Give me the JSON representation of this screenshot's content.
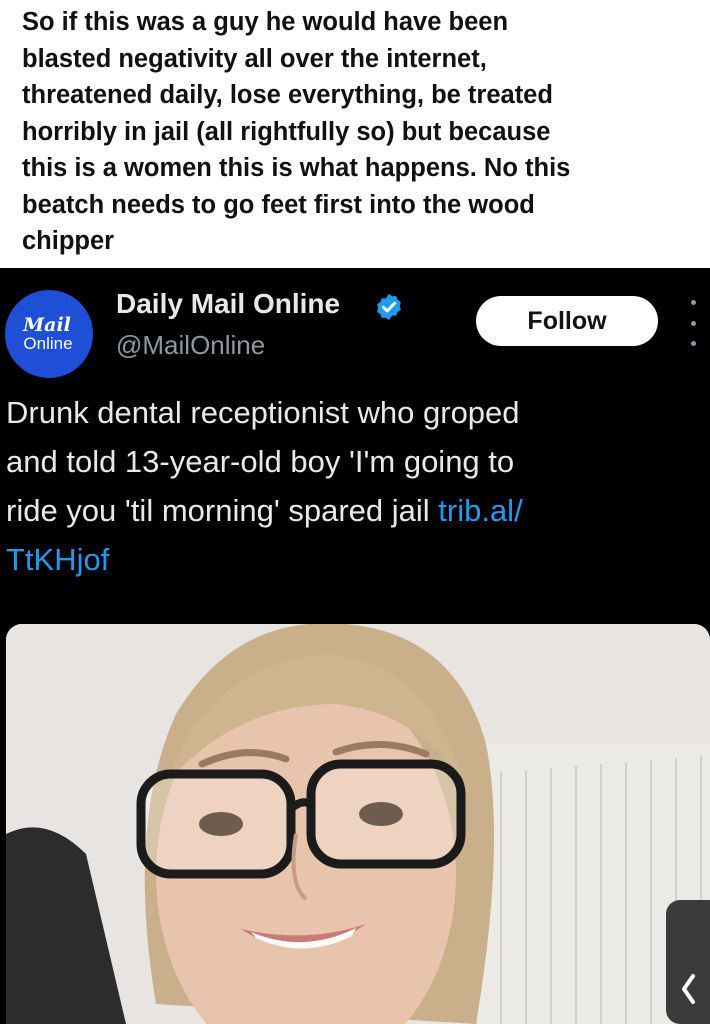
{
  "caption": {
    "lines": [
      "So if this was a guy he would have been",
      "blasted negativity all over the internet,",
      "threatened daily, lose everything, be treated",
      "horribly in jail (all rightfully so) but because",
      "this is a women this is what happens. No this",
      "beatch needs to go feet first into the wood",
      "chipper"
    ]
  },
  "tweet": {
    "avatar": {
      "line1": "Mail",
      "line2": "Online"
    },
    "display_name": "Daily Mail Online",
    "handle": "@MailOnline",
    "follow_label": "Follow",
    "text_lines": [
      "Drunk dental receptionist who groped",
      "and told 13-year-old boy 'I'm going to",
      "ride you 'til morning' spared jail "
    ],
    "link_part1": "trib.al/",
    "link_part2": "TtKHjof"
  },
  "icons": {
    "verified": "verified-badge-icon",
    "more": "more-options-icon",
    "back": "chevron-left-icon"
  },
  "colors": {
    "background": "#000000",
    "text": "#e7e9ea",
    "secondary": "#8b98a5",
    "link": "#1d9bf0",
    "avatar_blue": "#1e4fd6"
  }
}
